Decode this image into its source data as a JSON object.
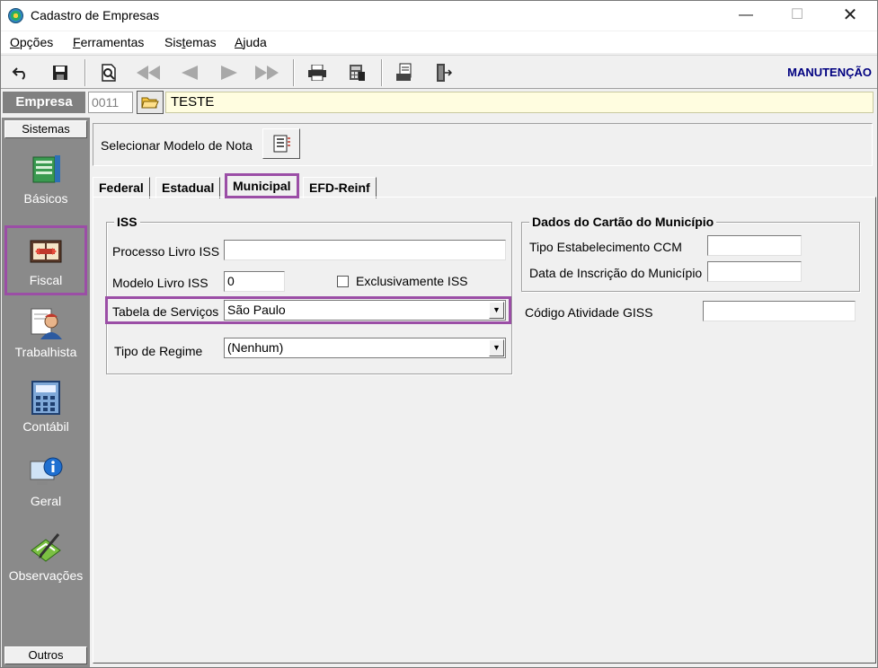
{
  "window": {
    "title": "Cadastro de Empresas",
    "minimize": "—",
    "maximize": "☐",
    "close": "✕"
  },
  "menu": [
    {
      "u": "O",
      "rest": "pções"
    },
    {
      "u": "F",
      "rest": "erramentas"
    },
    {
      "pre": "Sis",
      "u": "t",
      "rest": "emas"
    },
    {
      "u": "A",
      "rest": "juda"
    }
  ],
  "menu_labels": {
    "opcoes_u": "O",
    "opcoes_rest": "pções",
    "ferramentas_u": "F",
    "ferramentas_rest": "erramentas",
    "sistemas_pre": "Sis",
    "sistemas_u": "t",
    "sistemas_rest": "emas",
    "ajuda_u": "A",
    "ajuda_rest": "juda"
  },
  "toolbar": {
    "mode": "MANUTENÇÃO",
    "icons": [
      "undo-icon",
      "save-icon",
      "preview-icon",
      "first-icon",
      "prev-icon",
      "next-icon",
      "last-icon",
      "print-icon",
      "calculator-icon",
      "document-icon",
      "exit-icon"
    ]
  },
  "empresa": {
    "label": "Empresa",
    "code": "0011",
    "name": "TESTE"
  },
  "sidebar": {
    "header": "Sistemas",
    "footer": "Outros",
    "items": [
      {
        "label": "Básicos",
        "icon": "books-icon"
      },
      {
        "label": "Fiscal",
        "icon": "ledger-icon",
        "selected": true
      },
      {
        "label": "Trabalhista",
        "icon": "worker-icon"
      },
      {
        "label": "Contábil",
        "icon": "calculator-icon"
      },
      {
        "label": "Geral",
        "icon": "info-computer-icon"
      },
      {
        "label": "Observações",
        "icon": "pen-notes-icon"
      }
    ]
  },
  "modelo": {
    "label": "Selecionar Modelo de Nota"
  },
  "tabs": [
    {
      "label": "Federal"
    },
    {
      "label": "Estadual"
    },
    {
      "label": "Municipal",
      "active": true
    },
    {
      "label": "EFD-Reinf"
    }
  ],
  "iss": {
    "title": "ISS",
    "processo_label": "Processo Livro ISS",
    "processo_value": "",
    "modelo_label": "Modelo Livro ISS",
    "modelo_value": "0",
    "exclusivo_label": "Exclusivamente ISS",
    "exclusivo_checked": false,
    "tabela_label": "Tabela de Serviços",
    "tabela_value": "São Paulo",
    "regime_label": "Tipo de Regime",
    "regime_value": "(Nenhum)"
  },
  "cartao": {
    "title": "Dados do Cartão do Município",
    "ccm_label": "Tipo Estabelecimento CCM",
    "ccm_value": "",
    "inscricao_label": "Data de Inscrição do Município",
    "inscricao_value": "",
    "giss_label": "Código Atividade GISS",
    "giss_value": ""
  },
  "colors": {
    "highlight": "#9b4ea6",
    "sidebar_bg": "#8a8a8a",
    "mode_text": "#000080",
    "empresa_name_bg": "#fffde0"
  }
}
